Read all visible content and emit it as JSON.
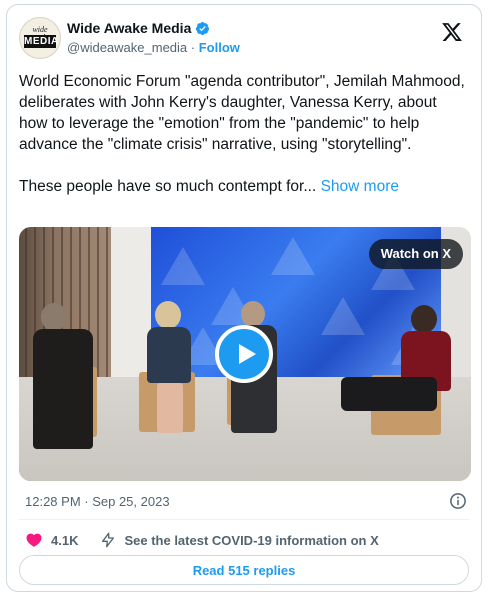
{
  "author": {
    "display_name": "Wide Awake Media",
    "handle": "@wideawake_media",
    "follow_label": "Follow",
    "avatar_top_text": "wide awake",
    "avatar_bottom_text": "MEDIA",
    "verified": true
  },
  "tweet": {
    "paragraph_1": "World Economic Forum \"agenda contributor\", Jemilah Mahmood, deliberates with John Kerry's daughter, Vanessa Kerry, about how to leverage the \"emotion\" from the \"pandemic\" to help advance the \"climate crisis\" narrative, using \"storytelling\".",
    "paragraph_2": "These people have so much contempt for...",
    "show_more_label": "Show more"
  },
  "media": {
    "watch_label": "Watch on X",
    "play_icon": "play-icon"
  },
  "meta": {
    "timestamp": "12:28 PM · Sep 25, 2023"
  },
  "actions": {
    "like_count": "4.1K",
    "covid_notice": "See the latest COVID-19 information on X"
  },
  "replies": {
    "label": "Read 515 replies"
  },
  "colors": {
    "accent": "#1d9bf0",
    "like": "#f91880",
    "muted": "#536471"
  }
}
